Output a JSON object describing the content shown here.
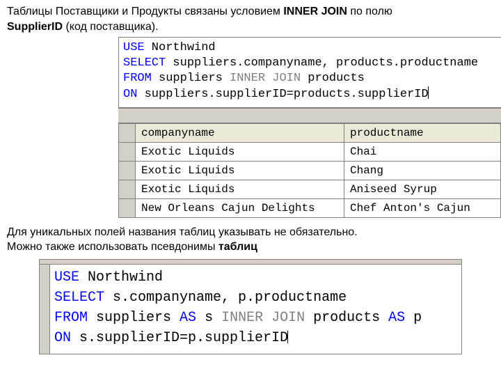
{
  "intro": {
    "pre1": "Таблицы Поставщики и Продукты связаны условием  ",
    "bold1": "INNER JOIN",
    "mid1": " по полю ",
    "bold2": "SupplierID",
    "post1": " (код поставщика)."
  },
  "sql1": {
    "l1_kw": "USE",
    "l1_rest": " Northwind",
    "l2_kw": "SELECT",
    "l2_rest": " suppliers.companyname, products.productname",
    "l3_kw1": "FROM",
    "l3_mid": " suppliers ",
    "l3_kw2": "INNER",
    "l3_sp": " ",
    "l3_kw3": "JOIN",
    "l3_rest": " products",
    "l4_kw": "ON",
    "l4_rest": " suppliers.supplierID=products.supplierID"
  },
  "table": {
    "headers": [
      "companyname",
      "productname"
    ],
    "rows": [
      [
        "Exotic Liquids",
        "Chai"
      ],
      [
        "Exotic Liquids",
        "Chang"
      ],
      [
        "Exotic Liquids",
        "Aniseed Syrup"
      ],
      [
        "New Orleans Cajun Delights",
        "Chef Anton's Cajun"
      ]
    ]
  },
  "para2": {
    "line1": "Для уникальных полей названия таблиц указывать не обязательно.",
    "line2_pre": "Можно также использовать псевдонимы ",
    "line2_b": "таблиц"
  },
  "sql2": {
    "l1_kw": "USE",
    "l1_rest": " Northwind",
    "l2_kw": "SELECT",
    "l2_rest": " s.companyname, p.productname",
    "l3_kw1": "FROM",
    "l3_a": " suppliers ",
    "l3_kw2": "AS",
    "l3_b": " s ",
    "l3_kw3": "INNER",
    "l3_sp": " ",
    "l3_kw4": "JOIN",
    "l3_c": " products ",
    "l3_kw5": "AS",
    "l3_d": " p",
    "l4_kw": "ON",
    "l4_rest": " s.supplierID=p.supplierID"
  }
}
